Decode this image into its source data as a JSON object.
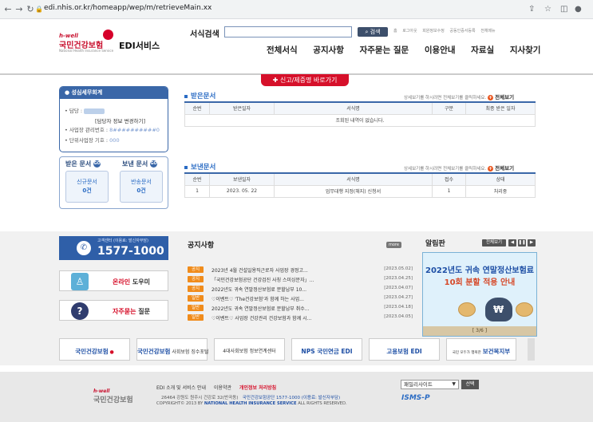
{
  "browser": {
    "url": "edi.nhis.or.kr/homeapp/wep/m/retrieveMain.xx",
    "back_icon": "←",
    "forward_icon": "→",
    "reload_icon": "↻"
  },
  "header": {
    "logo_hwell": "h-well",
    "logo_name": "국민건강보험",
    "logo_en": "National Health Insurance Service",
    "service_name": "EDI서비스",
    "search_label": "서식검색",
    "search_button": "검색",
    "util_links": [
      "홈",
      "로그아웃",
      "회원정보수정",
      "공동인증서등록",
      "전체메뉴"
    ],
    "gnb": [
      "전체서식",
      "공지사항",
      "자주묻는 질문",
      "이용안내",
      "자료실",
      "지사찾기"
    ],
    "report_button": "신고/제증명 바로가기"
  },
  "sidebar": {
    "title": "성심세무회계",
    "contact_label": "담당 :",
    "change_link": "[담당자 정보 변경하기]",
    "mgmt_label": "사업장 관리번호 :",
    "mgmt_value": "8##########0",
    "unit_label": "단위사업장 기호 :",
    "unit_value": "000",
    "received_title": "받은 문서",
    "sent_title": "보낸 문서",
    "new_docs_label": "신규문서",
    "new_docs_count": "0건",
    "returned_docs_label": "반송문서",
    "returned_docs_count": "0건"
  },
  "received": {
    "title": "받은문서",
    "hint": "상세보기를 하시려면 전체보기를 클릭하세요.",
    "view_all": "전체보기",
    "columns": [
      "순번",
      "받은일자",
      "서식명",
      "구분",
      "최종 받은 일자"
    ],
    "empty": "조회된 내역이 없습니다."
  },
  "sent": {
    "title": "보낸문서",
    "hint": "상세보기를 하시려면 전체보기를 클릭하세요.",
    "view_all": "전체보기",
    "columns": [
      "순번",
      "보낸일자",
      "서식명",
      "접수",
      "상태"
    ],
    "rows": [
      [
        "1",
        "2023. 05. 22",
        "업무대행 지정(해지) 신청서",
        "1",
        "처리중"
      ]
    ]
  },
  "quick": {
    "call_caption": "고객센터 (이용료: 발신자부담)",
    "call_number": "1577-1000",
    "online_help": "온라인",
    "online_help_2": "도우미",
    "faq": "자주묻는",
    "faq_2": "질문"
  },
  "notice": {
    "title": "공지사항",
    "more": "more",
    "items": [
      {
        "tag": "공지",
        "title": "2023년 4월 건설일용직근로자 사업장 경정고...",
        "date": "[2023.05.02]"
      },
      {
        "tag": "공지",
        "title": "「국민건강보험공단 건강검진 사칭 스미싱문자」...",
        "date": "[2023.04.25]"
      },
      {
        "tag": "공지",
        "title": "2022년도 귀속 연말정산보험료 분할납부 10...",
        "date": "[2023.04.07]"
      },
      {
        "tag": "일반",
        "title": "♡이벤트♡ 'The건강보험'과 함께 하는 사업...",
        "date": "[2023.04.27]"
      },
      {
        "tag": "일반",
        "title": "2022년도 귀속 연말정산보험료 분할납부 취수...",
        "date": "[2023.04.18]"
      },
      {
        "tag": "일반",
        "title": "♡이벤트♡ 사업장 건강관리 건강보험과 함께 시...",
        "date": "[2023.04.05]"
      }
    ]
  },
  "alarm": {
    "title": "알림판",
    "view_all": "전체보기",
    "prev": "◀",
    "pause": "❚❚",
    "next": "▶",
    "banner_line1": "2022년도 귀속 연말정산보험료",
    "banner_highlight": "10회 분할 적용 안내",
    "page": "[ 3/6 ]",
    "coin_label": "₩"
  },
  "partners": [
    {
      "name": "국민건강보험",
      "sub": "h-well"
    },
    {
      "name": "사회보험 징수포털",
      "sub": "국민건강보험"
    },
    {
      "name": "4대사회보험 정보연계센터",
      "sub": ""
    },
    {
      "name": "NPS 국민연금 EDI",
      "sub": ""
    },
    {
      "name": "고용보험 EDI",
      "sub": ""
    },
    {
      "name": "보건복지부",
      "sub": "국민 모두가 행복한"
    }
  ],
  "footer": {
    "links": [
      "EDI 소개 및 서비스 안내",
      "이용약관",
      "개인정보 처리방침"
    ],
    "address": "26464 강원도 원주시 건강로 32(반곡동)",
    "hotline": "국민건강보험공단 1577-1000 (이용료: 발신자부담)",
    "copyright_prefix": "COPYRIGHT© 2013 BY",
    "copyright_org": "NATIONAL HEALTH INSURANCE SERVICE",
    "copyright_suffix": "ALL RIGHTS RESERVED.",
    "family_site": "패밀리사이트",
    "family_go": "선택",
    "isms": "ISMS-P",
    "logo_hwell": "h-well",
    "logo_name": "국민건강보험"
  },
  "colors": {
    "brand_red": "#d6102a",
    "brand_blue": "#3a67a8",
    "notice_tag": "#f08c1c"
  }
}
